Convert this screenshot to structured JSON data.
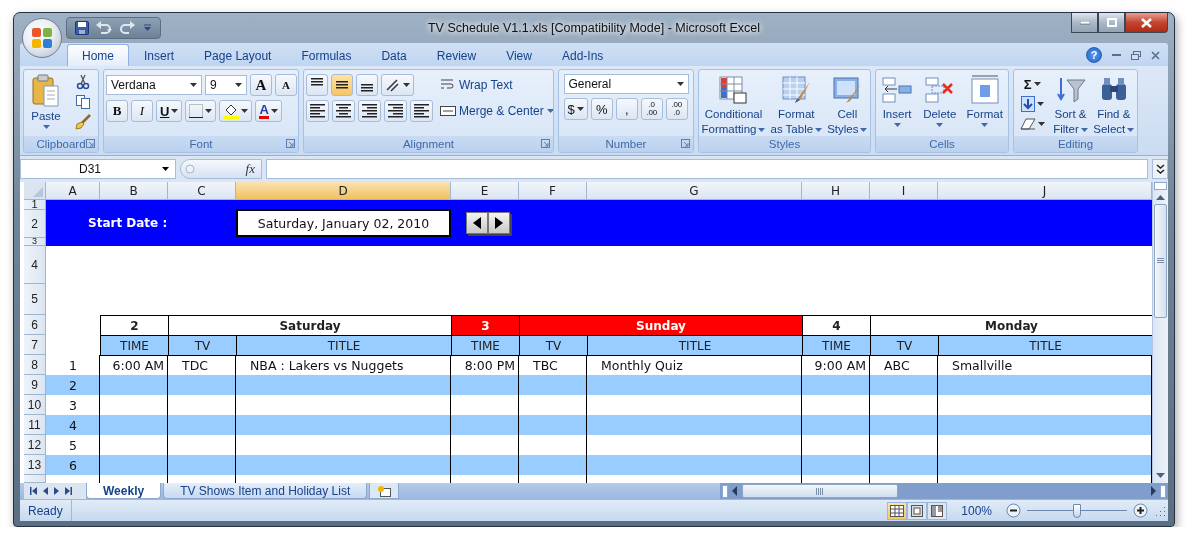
{
  "window": {
    "title": "TV Schedule V1.1.xls  [Compatibility Mode] - Microsoft Excel",
    "help": "?"
  },
  "ribbon_tabs": [
    {
      "label": "Home",
      "selected": true
    },
    {
      "label": "Insert",
      "selected": false
    },
    {
      "label": "Page Layout",
      "selected": false
    },
    {
      "label": "Formulas",
      "selected": false
    },
    {
      "label": "Data",
      "selected": false
    },
    {
      "label": "Review",
      "selected": false
    },
    {
      "label": "View",
      "selected": false
    },
    {
      "label": "Add-Ins",
      "selected": false
    }
  ],
  "clipboard": {
    "label": "Clipboard",
    "paste": "Paste"
  },
  "font": {
    "label": "Font",
    "name": "Verdana",
    "size": "9",
    "grow": "A",
    "shrink": "A",
    "bold": "B",
    "italic": "I",
    "underline": "U",
    "color_glyph": "A"
  },
  "alignment": {
    "label": "Alignment",
    "vertical": [
      {
        "kind": "top",
        "selected": false
      },
      {
        "kind": "middle",
        "selected": true
      },
      {
        "kind": "bottom",
        "selected": false
      }
    ],
    "wrap_text": "Wrap Text",
    "merge": "Merge & Center"
  },
  "number": {
    "label": "Number",
    "format": "General",
    "currency": "$",
    "percent": "%",
    "comma": ",",
    "increase_decimal": [
      ".0",
      ".00"
    ],
    "decrease_decimal": [
      ".00",
      ".0"
    ]
  },
  "styles": {
    "label": "Styles",
    "buttons": [
      {
        "kind": "conditional",
        "lines": [
          "Conditional",
          "Formatting"
        ]
      },
      {
        "kind": "table",
        "lines": [
          "Format",
          "as Table"
        ]
      },
      {
        "kind": "cell",
        "lines": [
          "Cell",
          "Styles"
        ]
      }
    ]
  },
  "cells": {
    "label": "Cells",
    "buttons": [
      {
        "kind": "insert",
        "label": "Insert"
      },
      {
        "kind": "delete",
        "label": "Delete"
      },
      {
        "kind": "format",
        "label": "Format"
      }
    ]
  },
  "editing": {
    "label": "Editing",
    "sum": "Σ",
    "buttons": [
      {
        "kind": "sort",
        "lines": [
          "Sort &",
          "Filter"
        ]
      },
      {
        "kind": "find",
        "lines": [
          "Find &",
          "Select"
        ]
      }
    ]
  },
  "formula_bar": {
    "name_box": "D31",
    "function": "fx"
  },
  "columns": [
    {
      "label": "A",
      "selected": false
    },
    {
      "label": "B",
      "selected": false
    },
    {
      "label": "C",
      "selected": false
    },
    {
      "label": "D",
      "selected": true
    },
    {
      "label": "E",
      "selected": false
    },
    {
      "label": "F",
      "selected": false
    },
    {
      "label": "G",
      "selected": false
    },
    {
      "label": "H",
      "selected": false
    },
    {
      "label": "I",
      "selected": false
    },
    {
      "label": "J",
      "selected": false
    }
  ],
  "row_numbers": [
    "1",
    "2",
    "3",
    "4",
    "5",
    "6",
    "7",
    "8",
    "9",
    "10",
    "11",
    "12",
    "13"
  ],
  "sheet": {
    "start_label": "Start Date :",
    "start_date": "Saturday, January 02, 2010",
    "slots": [
      "1",
      "2",
      "3",
      "4",
      "5",
      "6"
    ],
    "days": [
      {
        "number": "2",
        "name": "Saturday",
        "highlight": false,
        "headers": [
          "TIME",
          "TV",
          "TITLE"
        ],
        "entries": [
          {
            "time": "6:00 AM",
            "tv": "TDC",
            "title": "NBA : Lakers vs Nuggets"
          }
        ]
      },
      {
        "number": "3",
        "name": "Sunday",
        "highlight": true,
        "headers": [
          "TIME",
          "TV",
          "TITLE"
        ],
        "entries": [
          {
            "time": "8:00 PM",
            "tv": "TBC",
            "title": "Monthly Quiz"
          }
        ]
      },
      {
        "number": "4",
        "name": "Monday",
        "highlight": false,
        "headers": [
          "TIME",
          "TV",
          "TITLE"
        ],
        "entries": [
          {
            "time": "9:00 AM",
            "tv": "ABC",
            "title": "Smallville"
          }
        ]
      }
    ]
  },
  "sheet_tabs": [
    {
      "label": "Weekly",
      "selected": true
    },
    {
      "label": "TV Shows Item and Holiday List",
      "selected": false
    }
  ],
  "status_bar": {
    "text": "Ready",
    "zoom": "100%",
    "zoom_slider": {
      "level": 0.5
    },
    "views": [
      {
        "kind": "normal",
        "selected": true
      },
      {
        "kind": "page_layout",
        "selected": false
      },
      {
        "kind": "page_break",
        "selected": false
      }
    ]
  }
}
